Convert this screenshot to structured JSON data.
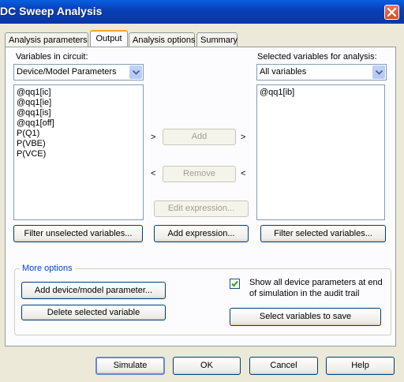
{
  "window": {
    "title": "DC Sweep Analysis",
    "close_icon": "close-icon"
  },
  "tabs": [
    {
      "label": "Analysis parameters",
      "active": false
    },
    {
      "label": "Output",
      "active": true
    },
    {
      "label": "Analysis options",
      "active": false
    },
    {
      "label": "Summary",
      "active": false
    }
  ],
  "left": {
    "label": "Variables in circuit:",
    "filter_value": "Device/Model Parameters",
    "items": [
      "@qq1[ic]",
      "@qq1[ie]",
      "@qq1[is]",
      "@qq1[off]",
      "P(Q1)",
      "P(VBE)",
      "P(VCE)"
    ],
    "filter_button": "Filter unselected variables..."
  },
  "right": {
    "label": "Selected variables for analysis:",
    "filter_value": "All variables",
    "items": [
      "@qq1[ib]"
    ],
    "filter_button": "Filter selected variables..."
  },
  "middle": {
    "add_left": ">",
    "add_label": "Add",
    "add_right": ">",
    "remove_left": "<",
    "remove_label": "Remove",
    "remove_right": "<",
    "edit_expression": "Edit expression...",
    "add_expression": "Add expression..."
  },
  "more_options": {
    "label": "More options",
    "add_param": "Add device/model parameter...",
    "delete_var": "Delete selected variable",
    "show_all_checked": true,
    "show_all_text": "Show all device parameters at end of simulation in the audit trail",
    "select_to_save": "Select variables to save"
  },
  "footer": {
    "simulate": "Simulate",
    "ok": "OK",
    "cancel": "Cancel",
    "help": "Help"
  },
  "colors": {
    "titlebar": "#0a5fe0",
    "window_bg": "#ece9d8",
    "group_label": "#0046d5",
    "active_tab_accent": "#f5a623",
    "close_button": "#d44a22"
  }
}
